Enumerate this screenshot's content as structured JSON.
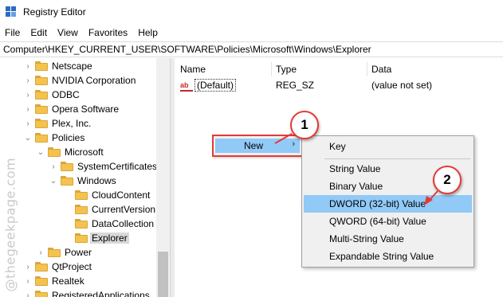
{
  "window": {
    "title": "Registry Editor"
  },
  "menu": [
    "File",
    "Edit",
    "View",
    "Favorites",
    "Help"
  ],
  "address": "Computer\\HKEY_CURRENT_USER\\SOFTWARE\\Policies\\Microsoft\\Windows\\Explorer",
  "tree": {
    "items": [
      {
        "label": "Netscape",
        "expanded": false
      },
      {
        "label": "NVIDIA Corporation",
        "expanded": false
      },
      {
        "label": "ODBC",
        "expanded": false
      },
      {
        "label": "Opera Software",
        "expanded": false
      },
      {
        "label": "Plex, Inc.",
        "expanded": false
      },
      {
        "label": "Policies",
        "expanded": true
      },
      {
        "label": "Microsoft",
        "expanded": true
      },
      {
        "label": "SystemCertificates",
        "expanded": false
      },
      {
        "label": "Windows",
        "expanded": true
      },
      {
        "label": "CloudContent",
        "expanded": false
      },
      {
        "label": "CurrentVersion",
        "expanded": false
      },
      {
        "label": "DataCollection",
        "expanded": false
      },
      {
        "label": "Explorer",
        "expanded": false,
        "selected": true
      },
      {
        "label": "Power",
        "expanded": false
      },
      {
        "label": "QtProject",
        "expanded": false
      },
      {
        "label": "Realtek",
        "expanded": false
      },
      {
        "label": "RegisteredApplications",
        "expanded": false
      }
    ]
  },
  "columns": {
    "name": "Name",
    "type": "Type",
    "data": "Data"
  },
  "values": [
    {
      "name": "(Default)",
      "type": "REG_SZ",
      "data": "(value not set)"
    }
  ],
  "context_menu": {
    "new_label": "New",
    "arrow": "›"
  },
  "submenu": {
    "key": "Key",
    "items": [
      "String Value",
      "Binary Value",
      "DWORD (32-bit) Value",
      "QWORD (64-bit) Value",
      "Multi-String Value",
      "Expandable String Value"
    ],
    "highlighted": "DWORD (32-bit) Value"
  },
  "steps": {
    "one": "1",
    "two": "2"
  },
  "watermark": "@thegeekpage.com",
  "colors": {
    "highlight": "#91c9f7",
    "callout": "#e53935",
    "folder": "#f4c34d"
  }
}
